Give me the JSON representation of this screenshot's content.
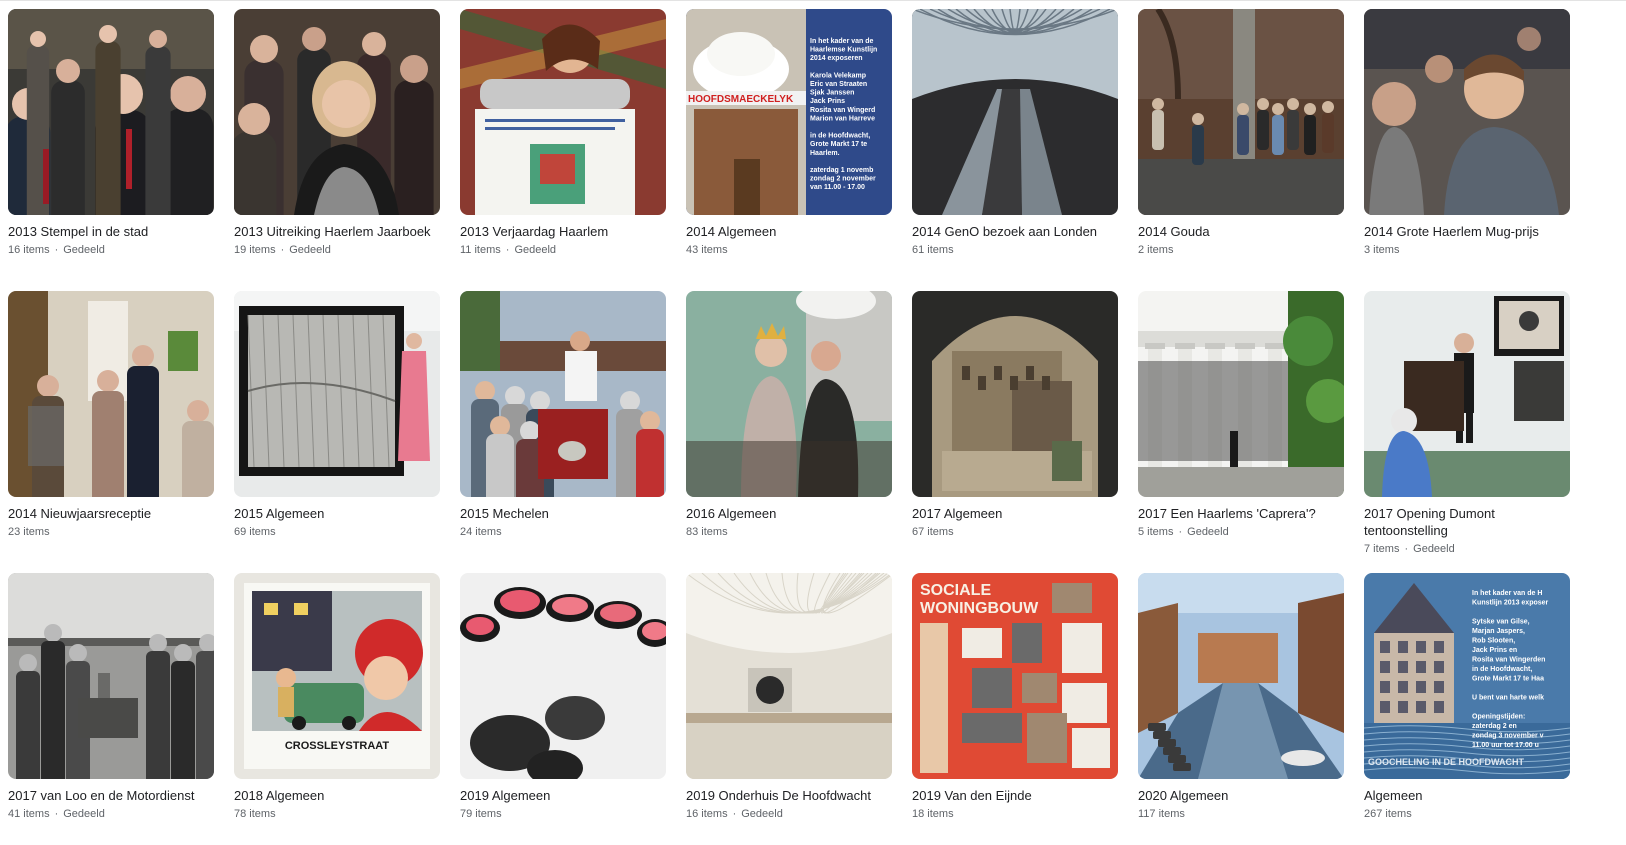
{
  "albums": [
    {
      "title": "2013 Stempel in de stad",
      "count": "16 items",
      "shared": "Gedeeld"
    },
    {
      "title": "2013 Uitreiking Haerlem Jaarboek",
      "count": "19 items",
      "shared": "Gedeeld"
    },
    {
      "title": "2013 Verjaardag Haarlem",
      "count": "11 items",
      "shared": "Gedeeld"
    },
    {
      "title": "2014 Algemeen",
      "count": "43 items",
      "shared": ""
    },
    {
      "title": "2014 GenO bezoek aan Londen",
      "count": "61 items",
      "shared": ""
    },
    {
      "title": "2014 Gouda",
      "count": "2 items",
      "shared": ""
    },
    {
      "title": "2014 Grote Haerlem Mug-prijs",
      "count": "3 items",
      "shared": ""
    },
    {
      "title": "2014 Nieuwjaarsreceptie",
      "count": "23 items",
      "shared": ""
    },
    {
      "title": "2015 Algemeen",
      "count": "69 items",
      "shared": ""
    },
    {
      "title": "2015 Mechelen",
      "count": "24 items",
      "shared": ""
    },
    {
      "title": "2016 Algemeen",
      "count": "83 items",
      "shared": ""
    },
    {
      "title": "2017 Algemeen",
      "count": "67 items",
      "shared": ""
    },
    {
      "title": "2017 Een Haarlems 'Caprera'?",
      "count": "5 items",
      "shared": "Gedeeld"
    },
    {
      "title": "2017 Opening Dumont tentoonstelling",
      "count": "7 items",
      "shared": "Gedeeld"
    },
    {
      "title": "2017 van Loo en de Motordienst",
      "count": "41 items",
      "shared": "Gedeeld"
    },
    {
      "title": "2018 Algemeen",
      "count": "78 items",
      "shared": ""
    },
    {
      "title": "2019 Algemeen",
      "count": "79 items",
      "shared": ""
    },
    {
      "title": "2019 Onderhuis De Hoofdwacht",
      "count": "16 items",
      "shared": "Gedeeld"
    },
    {
      "title": "2019 Van den Eijnde",
      "count": "18 items",
      "shared": ""
    },
    {
      "title": "2020 Algemeen",
      "count": "117 items",
      "shared": ""
    },
    {
      "title": "Algemeen",
      "count": "267 items",
      "shared": ""
    }
  ],
  "thumb_text": {
    "poster_2014": [
      "In het kader van de",
      "Haarlemse Kunstlijn",
      "2014 exposeren",
      "",
      "Karola Velekamp",
      "Eric van Straaten",
      "Sjak Janssen",
      "Jack Prins",
      "Rosita van Wingerd",
      "Marion van Harreve",
      "",
      "in de Hoofdwacht,",
      "Grote Markt 17 te",
      "Haarlem.",
      "",
      "zaterdag 1 novemb",
      "zondag 2 november",
      "van 11.00 - 17.00"
    ],
    "poster_2014_banner": "HOOFDSMAECKELYK",
    "sociale": [
      "SOCIALE",
      "WONINGBOUW"
    ],
    "crossley": "CROSSLEYSTRAAT",
    "poster_alg": [
      "In het kader van de H",
      "Kunstlijn 2013 exposer",
      "",
      "Sytske van Gilse,",
      "Marjan Jaspers,",
      "Rob Slooten,",
      "Jack Prins en",
      "Rosita van Wingerden",
      "in de Hoofdwacht,",
      "Grote Markt 17 te Haa",
      "",
      "U bent van harte welk",
      "",
      "Openingstijden:",
      "zaterdag 2 en",
      "zondag 3 november v",
      "11.00 uur tot 17.00 u"
    ],
    "poster_alg_footer": "GOOCHELING IN DE HOOFDWACHT"
  }
}
